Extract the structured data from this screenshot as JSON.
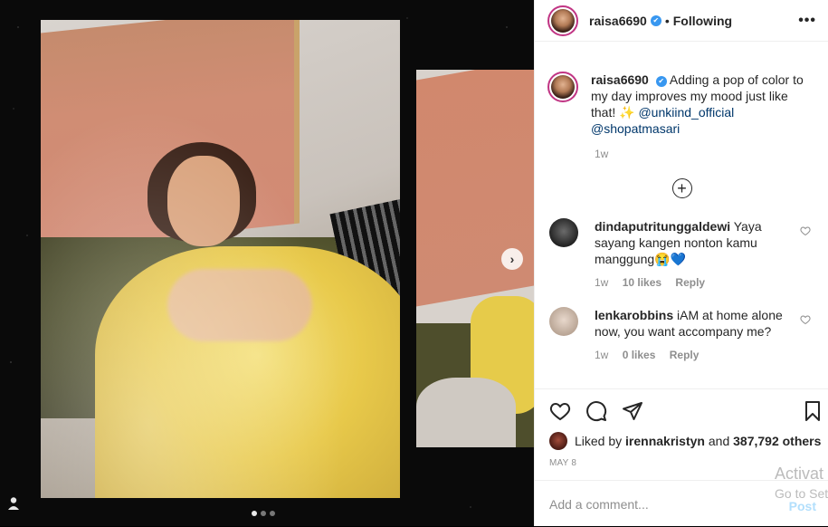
{
  "post": {
    "username": "raisa6690",
    "verified_mark": "✔",
    "separator": "•",
    "follow_status": "Following",
    "more_menu": "•••"
  },
  "caption": {
    "username": "raisa6690",
    "text": "Adding a pop of color to my day improves my mood just like that! ✨ ",
    "mention1": "@unkiind_official",
    "mention2": "@shopatmasari",
    "time": "1w"
  },
  "load_more_icon": "plus-circle-icon",
  "comments": [
    {
      "username": "dindaputritunggaldewi",
      "text": "Yaya sayang kangen nonton kamu manggung😭💙",
      "time": "1w",
      "likes": "10 likes",
      "reply": "Reply"
    },
    {
      "username": "lenkarobbins",
      "text": "iAM at home alone now, you want accompany me?",
      "time": "1w",
      "likes": "0 likes",
      "reply": "Reply"
    }
  ],
  "actions": {
    "like_icon": "heart-icon",
    "comment_icon": "comment-icon",
    "share_icon": "share-icon",
    "save_icon": "bookmark-icon"
  },
  "likes": {
    "prefix": "Liked by",
    "user": "irennakristyn",
    "middle": "and",
    "count": "387,792 others"
  },
  "date": "MAY 8",
  "add_comment": {
    "placeholder": "Add a comment...",
    "post_label": "Post"
  },
  "media": {
    "next_label": "›",
    "dots_count": 3,
    "active_dot": 1,
    "user_tag_icon": "user-icon"
  },
  "watermark": {
    "line1": "Activat",
    "line2": "Go to Set"
  }
}
